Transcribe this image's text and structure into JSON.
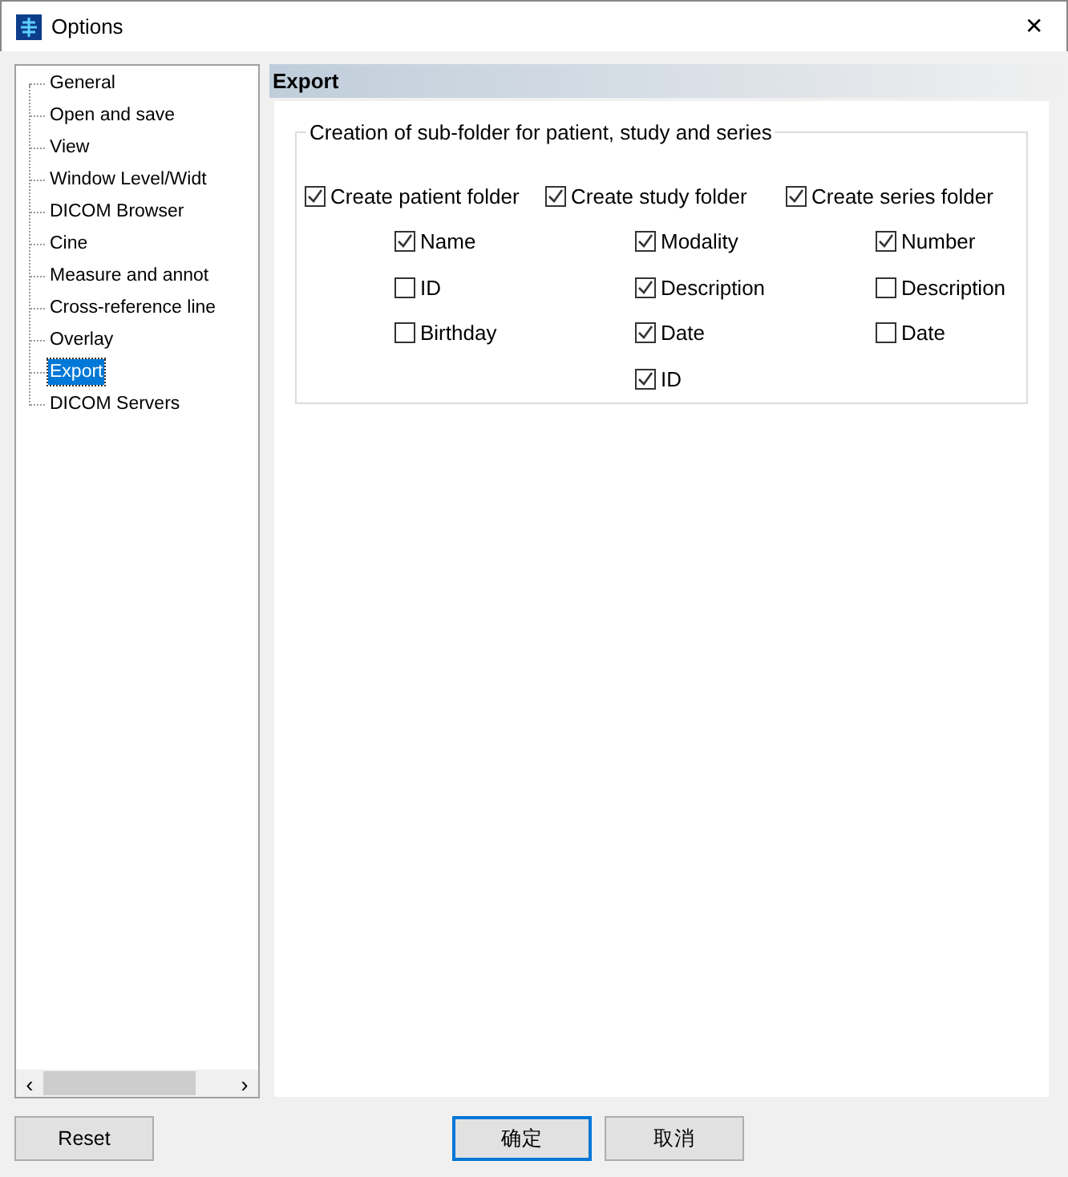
{
  "window": {
    "title": "Options",
    "close": "✕"
  },
  "tree": {
    "items": [
      {
        "label": "General",
        "selected": false
      },
      {
        "label": "Open and save",
        "selected": false
      },
      {
        "label": "View",
        "selected": false
      },
      {
        "label": "Window Level/Widt",
        "selected": false
      },
      {
        "label": "DICOM Browser",
        "selected": false
      },
      {
        "label": "Cine",
        "selected": false
      },
      {
        "label": "Measure and annot",
        "selected": false
      },
      {
        "label": "Cross-reference line",
        "selected": false
      },
      {
        "label": "Overlay",
        "selected": false
      },
      {
        "label": "Export",
        "selected": true
      },
      {
        "label": "DICOM Servers",
        "selected": false
      }
    ],
    "scroll_left": "‹",
    "scroll_right": "›"
  },
  "section_title": "Export",
  "group": {
    "legend": "Creation of sub-folder for patient, study and series",
    "folders": [
      {
        "label": "Create patient folder",
        "checked": true,
        "options": [
          {
            "label": "Name",
            "checked": true
          },
          {
            "label": "ID",
            "checked": false
          },
          {
            "label": "Birthday",
            "checked": false
          }
        ]
      },
      {
        "label": "Create study folder",
        "checked": true,
        "options": [
          {
            "label": "Modality",
            "checked": true
          },
          {
            "label": "Description",
            "checked": true
          },
          {
            "label": "Date",
            "checked": true
          },
          {
            "label": "ID",
            "checked": true
          }
        ]
      },
      {
        "label": "Create series folder",
        "checked": true,
        "options": [
          {
            "label": "Number",
            "checked": true
          },
          {
            "label": "Description",
            "checked": false
          },
          {
            "label": "Date",
            "checked": false
          }
        ]
      }
    ]
  },
  "buttons": [
    {
      "label": "Reset",
      "kind": "left",
      "focused": false
    },
    {
      "label": "确定",
      "kind": "right",
      "focused": true
    },
    {
      "label": "取消",
      "kind": "right",
      "focused": false
    }
  ]
}
